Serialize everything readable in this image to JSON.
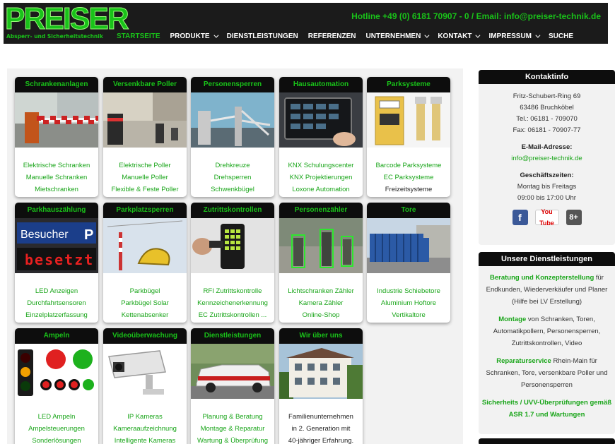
{
  "header": {
    "logo_text": "PREISER",
    "logo_sub": "Absperr- und Sicherheitstechnik",
    "hotline": "Hotline +49 (0) 6181 70907 - 0  / Email: info@preiser-technik.de",
    "nav": [
      {
        "label": "STARTSEITE",
        "active": true,
        "dropdown": false
      },
      {
        "label": "PRODUKTE",
        "active": false,
        "dropdown": true
      },
      {
        "label": "DIENSTLEISTUNGEN",
        "active": false,
        "dropdown": false
      },
      {
        "label": "REFERENZEN",
        "active": false,
        "dropdown": false
      },
      {
        "label": "UNTERNEHMEN",
        "active": false,
        "dropdown": true
      },
      {
        "label": "KONTAKT",
        "active": false,
        "dropdown": true
      },
      {
        "label": "IMPRESSUM",
        "active": false,
        "dropdown": true
      },
      {
        "label": "SUCHE",
        "active": false,
        "dropdown": false
      }
    ]
  },
  "cards": [
    {
      "title": "Schrankenanlagen",
      "links": [
        "Elektrische Schranken",
        "Manuelle Schranken",
        "Mietschranken"
      ]
    },
    {
      "title": "Versenkbare Poller",
      "links": [
        "Elektrische Poller",
        "Manuelle Poller",
        "Flexible & Feste Poller"
      ]
    },
    {
      "title": "Personensperren",
      "links": [
        "Drehkreuze",
        "Drehsperren",
        "Schwenkbügel"
      ]
    },
    {
      "title": "Hausautomation",
      "links": [
        "KNX Schulungscenter",
        "KNX Projektierungen",
        "Loxone Automation"
      ]
    },
    {
      "title": "Parksysteme",
      "links": [
        "Barcode Parksysteme",
        "EC Parksysteme",
        "Freizeitsysteme"
      ]
    },
    {
      "title": "Parkhauszählung",
      "links": [
        "LED Anzeigen",
        "Durchfahrtsensoren",
        "Einzelplatzerfassung"
      ],
      "img_text": [
        "Besucher",
        "P",
        "besetzt"
      ]
    },
    {
      "title": "Parkplatzsperren",
      "links": [
        "Parkbügel",
        "Parkbügel Solar",
        "Kettenabsenker"
      ]
    },
    {
      "title": "Zutrittskontrollen",
      "links": [
        "RFI Zutrittskontrolle",
        "Kennzeichenerkennung",
        "EC Zutrittskontrollen ..."
      ]
    },
    {
      "title": "Personenzähler",
      "links": [
        "Lichtschranken Zähler",
        "Kamera Zähler",
        "Online-Shop"
      ]
    },
    {
      "title": "Tore",
      "links": [
        "Industrie Schiebetore",
        "Aluminium Hoftore",
        "Vertikaltore"
      ]
    },
    {
      "title": "Ampeln",
      "links": [
        "LED Ampeln",
        "Ampelsteuerungen",
        "Sonderlösungen"
      ]
    },
    {
      "title": "Videoüberwachung",
      "links": [
        "IP Kameras",
        "Kameraaufzeichnung",
        "Intelligente Kameras"
      ]
    },
    {
      "title": "Dienstleistungen",
      "links": [
        "Planung & Beratung",
        "Montage & Reparatur",
        "Wartung & Überprüfung"
      ]
    },
    {
      "title": "Wir über uns",
      "links": [
        "Familienunternehmen",
        "in 2. Generation mit",
        "40-jähriger Erfahrung."
      ]
    }
  ],
  "sidebar": {
    "contact_title": "Kontaktinfo",
    "address": [
      "Fritz-Schubert-Ring 69",
      "63486 Bruchköbel",
      "Tel.: 06181 - 709070",
      "Fax: 06181 - 70907-77"
    ],
    "email_label": "E-Mail-Adresse:",
    "email": "info@preiser-technik.de",
    "hours_label": "Geschäftszeiten:",
    "hours": [
      "Montag bis Freitags",
      "09:00 bis 17:00 Uhr"
    ],
    "social": [
      {
        "name": "facebook-icon",
        "glyph": "f"
      },
      {
        "name": "youtube-icon",
        "glyph": "You Tube"
      },
      {
        "name": "googleplus-icon",
        "glyph": "8+"
      }
    ],
    "services_title": "Unsere Dienstleistungen",
    "services": [
      {
        "bold": "Beratung und Konzepterstellung",
        "rest": " für Endkunden, Wiederverkäufer und Planer (Hilfe bei LV Erstellung)"
      },
      {
        "bold": "Montage",
        "rest": " von Schranken, Toren, Automatikpollern, Personensperren, Zutrittskontrollen, Video"
      },
      {
        "bold": "Reparaturservice",
        "rest": " Rhein-Main für Schranken, Tore, versenkbare Poller und Personensperren"
      },
      {
        "bold": "Sicherheits / UVV-Überprüfungen gemäß ASR 1.7 und Wartungen",
        "rest": ""
      }
    ]
  },
  "colors": {
    "brand_green": "#19c219",
    "link_green": "#19a519",
    "header_bg": "#1b1b1b",
    "title_bg": "#0d0d0d"
  }
}
